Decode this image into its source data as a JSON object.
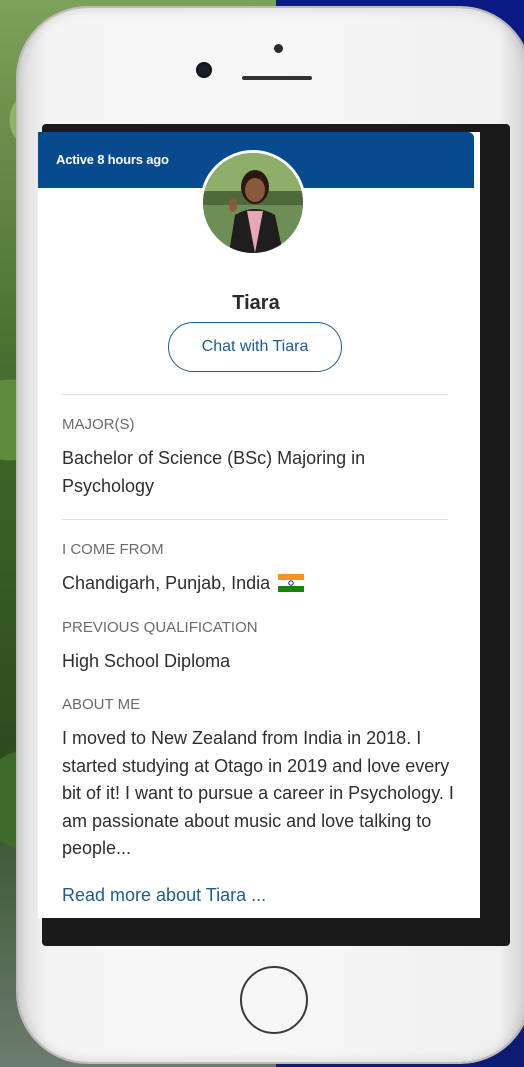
{
  "profile": {
    "active_status": "Active 8 hours ago",
    "name": "Tiara",
    "chat_button_label": "Chat with Tiara",
    "major_label": "MAJOR(S)",
    "major_value": "Bachelor of Science (BSc) Majoring in Psychology",
    "come_from_label": "I COME FROM",
    "come_from_value": "Chandigarh, Punjab, India",
    "flag_icon": "india-flag-icon",
    "qualification_label": "PREVIOUS QUALIFICATION",
    "qualification_value": "High School Diploma",
    "about_label": "ABOUT ME",
    "about_value": "I moved to New Zealand from India in 2018. I started studying at Otago in 2019 and love every bit of it! I want to pursue a career in Psychology. I am passionate about music and love talking to people...",
    "read_more_label": "Read more about Tiara ..."
  },
  "colors": {
    "banner": "#074a8d",
    "link": "#1c5c94",
    "label_gray": "#6b6b6b",
    "text": "#2e2e2e"
  }
}
